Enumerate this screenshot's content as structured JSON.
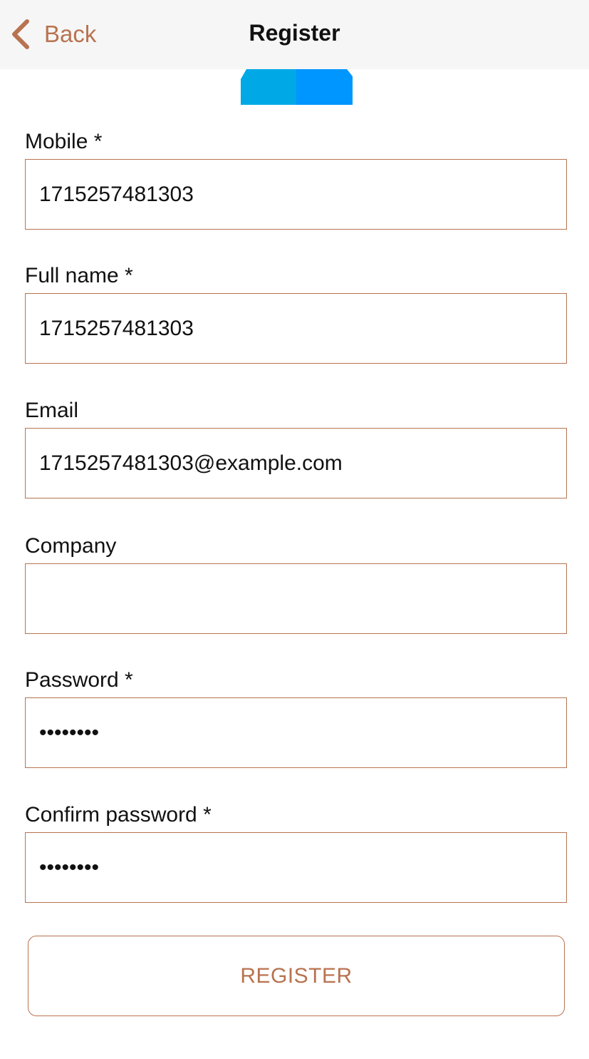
{
  "navbar": {
    "back_label": "Back",
    "title": "Register",
    "accent_color": "#b87350",
    "background": "#f6f6f6"
  },
  "logo": {
    "icon": "brand-logo-icon",
    "colors": [
      "#00a8e6",
      "#0096ff"
    ]
  },
  "form": {
    "fields": [
      {
        "label": "Mobile *",
        "value": "1715257481303",
        "type": "tel"
      },
      {
        "label": "Full name *",
        "value": "1715257481303",
        "type": "text"
      },
      {
        "label": "Email",
        "value": "1715257481303@example.com",
        "type": "email"
      },
      {
        "label": "Company",
        "value": "",
        "type": "text"
      },
      {
        "label": "Password *",
        "value": "••••••••",
        "type": "password"
      },
      {
        "label": "Confirm password *",
        "value": "••••••••",
        "type": "password"
      }
    ],
    "border_color": "#b87350"
  },
  "register_button": {
    "label": "REGISTER",
    "color": "#b87350"
  }
}
